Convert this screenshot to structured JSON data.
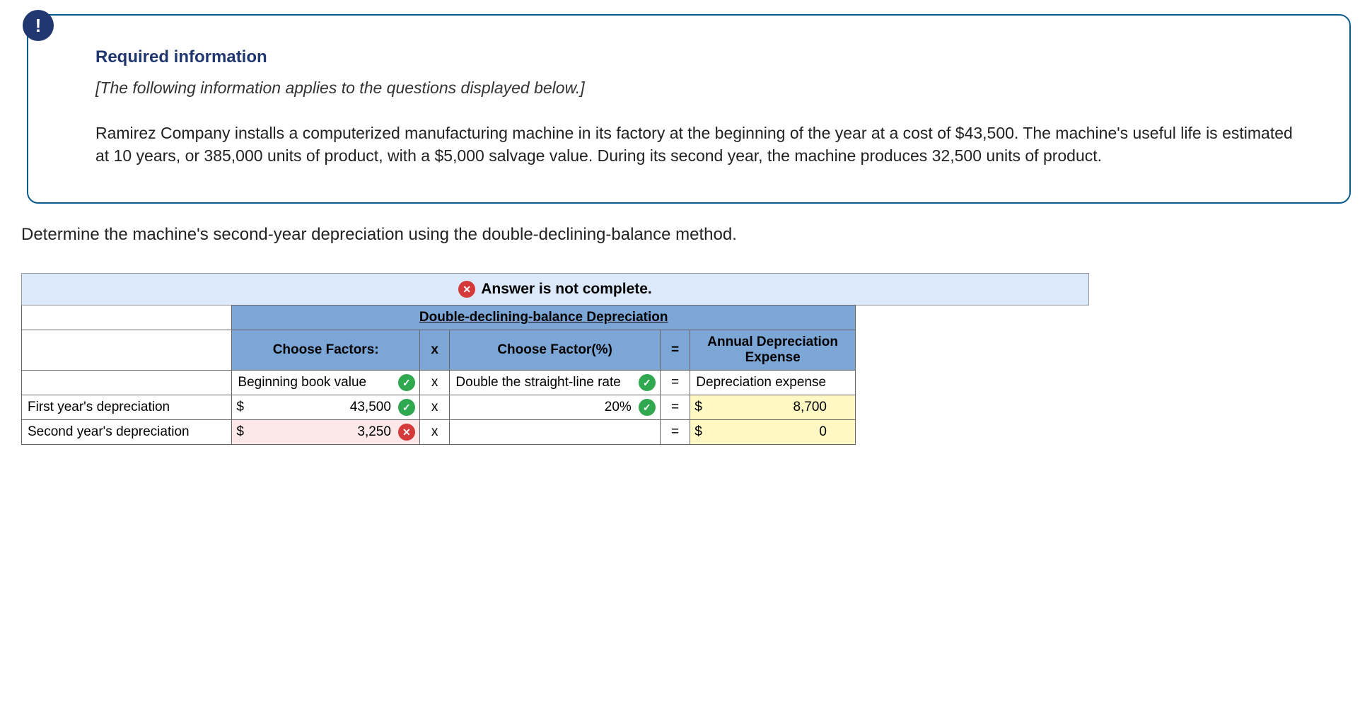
{
  "info": {
    "icon_glyph": "!",
    "title": "Required information",
    "subtitle": "[The following information applies to the questions displayed below.]",
    "body": "Ramirez Company installs a computerized manufacturing machine in its factory at the beginning of the year at a cost of $43,500. The machine's useful life is estimated at 10 years, or 385,000 units of product, with a $5,000 salvage value. During its second year, the machine produces 32,500 units of product."
  },
  "question": "Determine the machine's second-year depreciation using the double-declining-balance method.",
  "banner": "Answer is not complete.",
  "table": {
    "title": "Double-declining-balance Depreciation",
    "headers": {
      "choose_factors": "Choose Factors:",
      "x1": "x",
      "choose_factor_pct": "Choose Factor(%)",
      "eq": "=",
      "annual": "Annual Depreciation Expense"
    },
    "guide_row": {
      "factor_label": "Beginning book value",
      "x": "x",
      "pct_label": "Double the straight-line rate",
      "eq": "=",
      "result_label": "Depreciation expense"
    },
    "rows": [
      {
        "label": "First year's depreciation",
        "currency": "$",
        "value": "43,500",
        "value_status": "correct",
        "x": "x",
        "pct": "20%",
        "pct_status": "correct",
        "eq": "=",
        "result_currency": "$",
        "result": "8,700"
      },
      {
        "label": "Second year's depreciation",
        "currency": "$",
        "value": "3,250",
        "value_status": "incorrect",
        "x": "x",
        "pct": "",
        "pct_status": "",
        "eq": "=",
        "result_currency": "$",
        "result": "0"
      }
    ]
  }
}
